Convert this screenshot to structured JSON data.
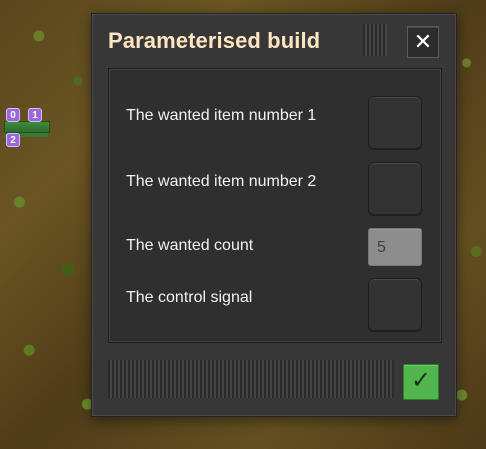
{
  "world": {
    "signals": [
      "0",
      "1",
      "2"
    ]
  },
  "dialog": {
    "title": "Parameterised build",
    "close_icon": "close-icon",
    "rows": [
      {
        "label": "The wanted item number 1",
        "kind": "slot"
      },
      {
        "label": "The wanted item number 2",
        "kind": "slot"
      },
      {
        "label": "The wanted count",
        "kind": "count",
        "value": "5"
      },
      {
        "label": "The control signal",
        "kind": "slot"
      }
    ],
    "confirm_icon": "check-icon",
    "colors": {
      "title": "#ffe6c0",
      "dialog_bg": "#373737",
      "content_bg": "#2f2f2f",
      "confirm": "#52b64f"
    }
  }
}
